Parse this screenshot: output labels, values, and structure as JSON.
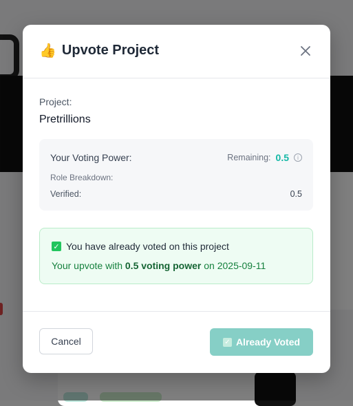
{
  "modal": {
    "title": "Upvote Project",
    "icon": "thumbs-up-icon",
    "close_icon": "close-icon"
  },
  "project": {
    "label": "Project:",
    "name": "Pretrillions"
  },
  "voting_power": {
    "title": "Your Voting Power:",
    "remaining_label": "Remaining:",
    "remaining_value": "0.5",
    "role_breakdown_label": "Role Breakdown:",
    "verified_label": "Verified:",
    "verified_value": "0.5"
  },
  "vote_status": {
    "message": "You have already voted on this project",
    "detail_prefix": "Your upvote with",
    "detail_power": "0.5 voting power",
    "detail_suffix": "on 2025-09-11"
  },
  "footer": {
    "cancel_label": "Cancel",
    "voted_label": "Already Voted"
  },
  "colors": {
    "accent": "#14b8a6",
    "success_bg": "#eefcf3",
    "success_text": "#15803d",
    "disabled_button": "#86cfc6"
  }
}
